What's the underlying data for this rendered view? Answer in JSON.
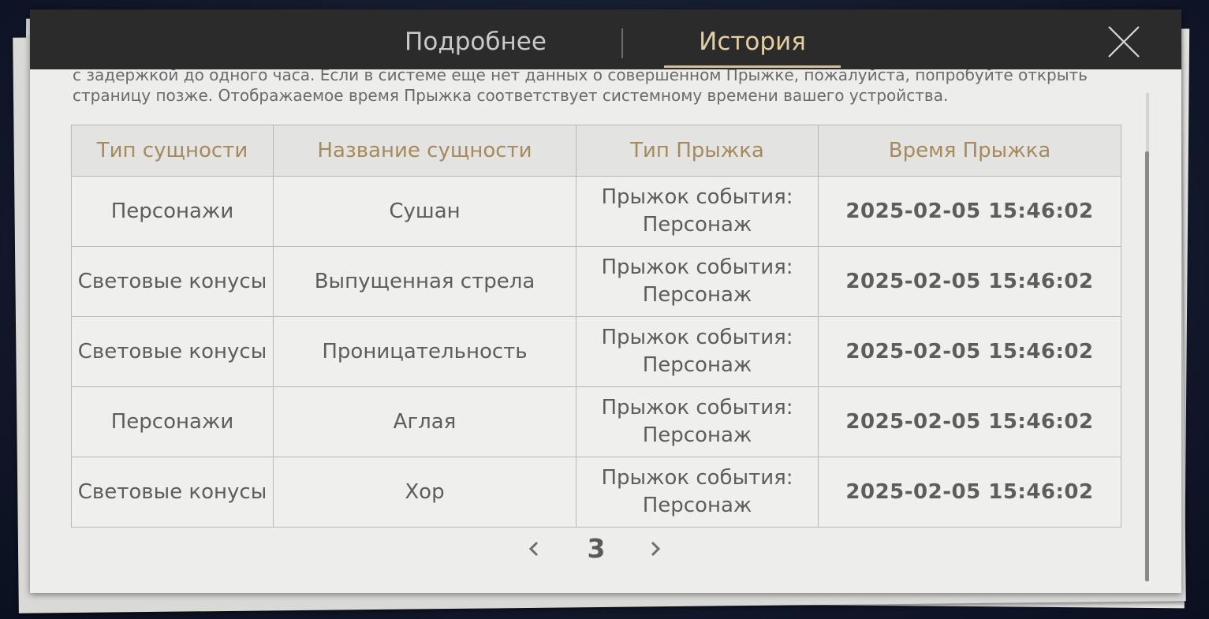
{
  "tabs": {
    "details": "Подробнее",
    "history": "История",
    "active": "history"
  },
  "notice": "с задержкой до одного часа. Если в системе еще нет данных о совершенном Прыжке, пожалуйста, попробуйте открыть страницу позже. Отображаемое время Прыжка соответствует системному времени вашего устройства.",
  "table": {
    "headers": [
      "Тип сущности",
      "Название сущности",
      "Тип Прыжка",
      "Время Прыжка"
    ],
    "rows": [
      {
        "type": "Персонажи",
        "name": "Сушан",
        "warp_line1": "Прыжок события:",
        "warp_line2": "Персонаж",
        "time": "2025-02-05 15:46:02"
      },
      {
        "type": "Световые конусы",
        "name": "Выпущенная стрела",
        "warp_line1": "Прыжок события:",
        "warp_line2": "Персонаж",
        "time": "2025-02-05 15:46:02"
      },
      {
        "type": "Световые конусы",
        "name": "Проницательность",
        "warp_line1": "Прыжок события:",
        "warp_line2": "Персонаж",
        "time": "2025-02-05 15:46:02"
      },
      {
        "type": "Персонажи",
        "name": "Аглая",
        "warp_line1": "Прыжок события:",
        "warp_line2": "Персонаж",
        "time": "2025-02-05 15:46:02"
      },
      {
        "type": "Световые конусы",
        "name": "Хор",
        "warp_line1": "Прыжок события:",
        "warp_line2": "Персонаж",
        "time": "2025-02-05 15:46:02"
      }
    ]
  },
  "pagination": {
    "current_page": "3"
  },
  "icons": {
    "close": "close-icon",
    "prev": "chevron-left-icon",
    "next": "chevron-right-icon"
  },
  "colors": {
    "header_bg": "#2b2b2b",
    "active_tab": "#e4cfa3",
    "rarity_4_star": "#a55ad8",
    "rarity_5_star": "#c99b52"
  }
}
